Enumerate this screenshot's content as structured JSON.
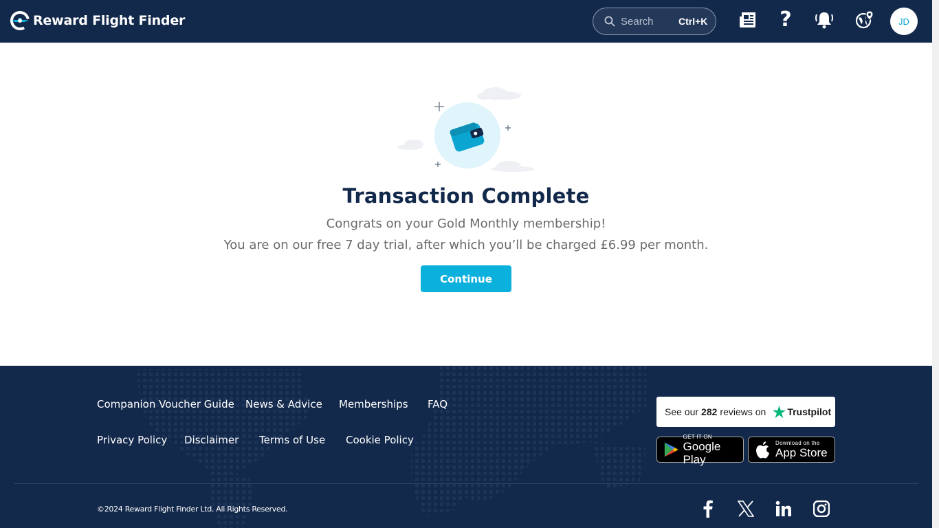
{
  "header": {
    "brand": "Reward Flight Finder",
    "search_placeholder": "Search",
    "search_shortcut": "Ctrl+K",
    "avatar_initials": "JD",
    "icons": [
      "news-icon",
      "help-icon",
      "notifications-bell-icon",
      "globe-location-icon"
    ]
  },
  "main": {
    "title": "Transaction Complete",
    "line1": "Congrats on your Gold Monthly membership!",
    "line2": "You are on our free 7 day trial, after which you’ll be charged £6.99 per month.",
    "continue_label": "Continue",
    "illustration": "wallet-icon"
  },
  "footer": {
    "links_row1": [
      "Companion Voucher Guide",
      "News & Advice",
      "Memberships",
      "FAQ"
    ],
    "links_row2": [
      "Privacy Policy",
      "Disclaimer",
      "Terms of Use",
      "Cookie Policy"
    ],
    "trustpilot": {
      "prefix": "See our",
      "count": "282",
      "suffix": "reviews on",
      "brand": "Trustpilot"
    },
    "google_play": {
      "small": "GET IT ON",
      "big": "Google Play"
    },
    "app_store": {
      "small": "Download on the",
      "big": "App Store"
    },
    "copyright": "©2024 Reward Flight Finder Ltd. All Rights Reserved.",
    "social": [
      "facebook-icon",
      "x-icon",
      "linkedin-icon",
      "instagram-icon"
    ]
  },
  "colors": {
    "navy": "#13294b",
    "accent": "#0bb0dd",
    "body_text": "#6a6a6a"
  }
}
